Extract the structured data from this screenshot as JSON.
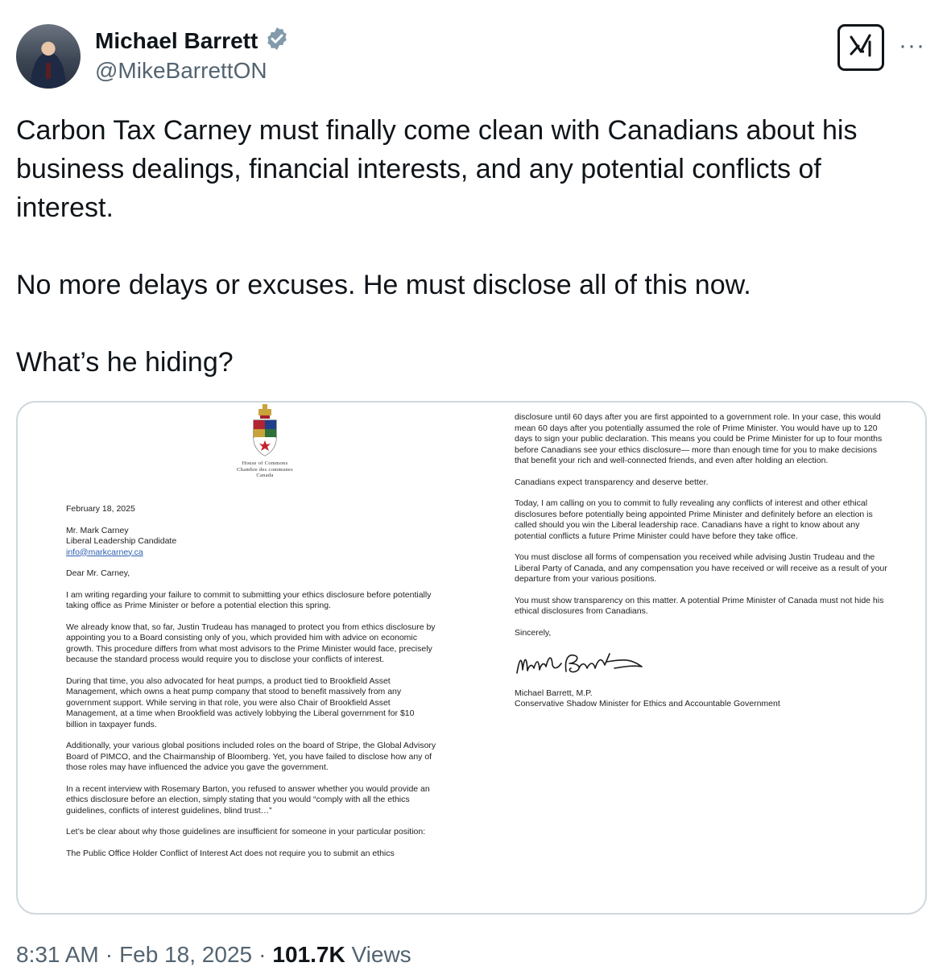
{
  "author": {
    "name": "Michael Barrett",
    "handle": "@MikeBarrettON"
  },
  "icons": {
    "verified": "verified-badge-icon",
    "grok": "grok-icon",
    "more": "more-icon"
  },
  "colors": {
    "verified": "#829aab",
    "secondary_text": "#536471"
  },
  "tweet": {
    "paragraphs": [
      "Carbon Tax Carney must finally come clean with Canadians about his business dealings, financial interests, and any potential conflicts of interest.",
      "No more delays or excuses. He must disclose all of this now.",
      "What’s he hiding?"
    ]
  },
  "letter": {
    "letterhead": [
      "House of Commons",
      "Chambre des communes",
      "Canada"
    ],
    "date": "February 18, 2025",
    "recipient": [
      "Mr. Mark Carney",
      "Liberal Leadership Candidate"
    ],
    "recipient_email": "info@markcarney.ca",
    "salutation": "Dear Mr. Carney,",
    "left_paragraphs": [
      "I am writing regarding your failure to commit to submitting your ethics disclosure before potentially taking office as Prime Minister or before a potential election this spring.",
      "We already know that, so far, Justin Trudeau has managed to protect you from ethics disclosure by appointing you to a Board consisting only of you, which provided him with advice on economic growth. This procedure differs from what most advisors to the Prime Minister would face, precisely because the standard process would require you to disclose your conflicts of interest.",
      "During that time, you also advocated for heat pumps, a product tied to Brookfield Asset Management, which owns a heat pump company that stood to benefit massively from any government support. While serving in that role, you were also Chair of Brookfield Asset Management, at a time when Brookfield was actively lobbying the Liberal government for $10 billion in taxpayer funds.",
      "Additionally, your various global positions included roles on the board of Stripe, the Global Advisory Board of PIMCO, and the Chairmanship of Bloomberg. Yet, you have failed to disclose how any of those roles may have influenced the advice you gave the government.",
      "In a recent interview with Rosemary Barton, you refused to answer whether you would provide an ethics disclosure before an election, simply stating that you would “comply with all the ethics guidelines, conflicts of interest guidelines, blind trust…”",
      "Let’s be clear about why those guidelines are insufficient for someone in your particular position:",
      "The Public Office Holder Conflict of Interest Act does not require you to submit an ethics"
    ],
    "right_paragraphs": [
      "disclosure until 60 days after you are first appointed to a government role. In your case, this would mean 60 days after you potentially assumed the role of Prime Minister. You would have up to 120 days to sign your public declaration. This means you could be Prime Minister for up to four months before Canadians see your ethics disclosure— more than enough time for you to make decisions that benefit your rich and well-connected friends, and even after holding an election.",
      "Canadians expect transparency and deserve better.",
      "Today, I am calling on you to commit to fully revealing any conflicts of interest and other ethical disclosures before potentially being appointed Prime Minister and definitely before an election is called should you win the Liberal leadership race. Canadians have a right to know about any potential conflicts a future Prime Minister could have before they take office.",
      "You must disclose all forms of compensation you received while advising Justin Trudeau and the Liberal Party of Canada, and any compensation you have received or will receive as a result of your departure from your various positions.",
      "You must show transparency on this matter. A potential Prime Minister of Canada must not hide his ethical disclosures from Canadians."
    ],
    "closing": "Sincerely,",
    "signature_name": "Michael Barrett, M.P.",
    "signature_title": "Conservative Shadow Minister for Ethics and Accountable Government"
  },
  "meta": {
    "time": "8:31 AM",
    "date": "Feb 18, 2025",
    "views_count": "101.7K",
    "views_label": "Views"
  }
}
